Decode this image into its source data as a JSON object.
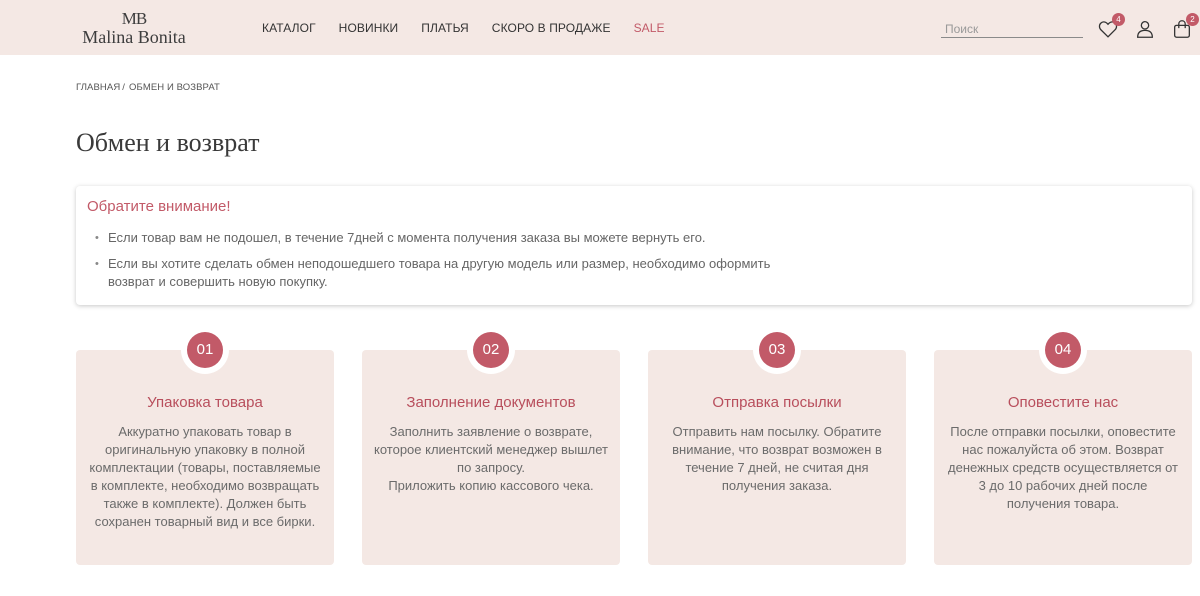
{
  "header": {
    "logo_mark": "MB",
    "logo_text": "Malina Bonita",
    "nav": [
      {
        "label": "КАТАЛОГ",
        "sale": false
      },
      {
        "label": "НОВИНКИ",
        "sale": false
      },
      {
        "label": "ПЛАТЬЯ",
        "sale": false
      },
      {
        "label": "СКОРО В ПРОДАЖЕ",
        "sale": false
      },
      {
        "label": "SALE",
        "sale": true
      }
    ],
    "search_placeholder": "Поиск",
    "wishlist_count": "4",
    "cart_count": "2",
    "icons": {
      "wishlist": "heart-icon",
      "account": "user-icon",
      "cart": "bag-icon"
    }
  },
  "breadcrumb": {
    "home": "ГЛАВНАЯ",
    "separator": "/",
    "current": "ОБМЕН И ВОЗВРАТ"
  },
  "page": {
    "title": "Обмен и возврат"
  },
  "notice": {
    "title": "Обратите внимание!",
    "items": [
      "Если товар вам не подошел, в течение 7дней с момента получения заказа вы можете вернуть его.",
      "Если вы хотите сделать обмен неподошедшего товара на другую модель или размер, необходимо оформить возврат и совершить новую покупку."
    ]
  },
  "steps": [
    {
      "number": "01",
      "title": "Упаковка товара",
      "text": "Аккуратно упаковать товар в оригинальную упаковку в полной комплектации (товары, поставляемые в комплекте, необходимо возвращать также в комплекте). Должен быть сохранен товарный вид и все бирки."
    },
    {
      "number": "02",
      "title": "Заполнение документов",
      "text": "Заполнить заявление о возврате, которое клиентский менеджер вышлет по запросу.\nПриложить копию кассового чека."
    },
    {
      "number": "03",
      "title": "Отправка посылки",
      "text": "Отправить нам посылку. Обратите внимание, что возврат возможен в течение 7 дней, не считая дня получения заказа."
    },
    {
      "number": "04",
      "title": "Оповестите нас",
      "text": "После отправки посылки, оповестите нас пожалуйста об этом. Возврат денежных средств осуществляется от 3 до 10 рабочих дней после получения товара."
    }
  ],
  "colors": {
    "accent": "#c25a68",
    "header_bg": "#f4e8e4",
    "card_bg": "#f4e8e4"
  }
}
